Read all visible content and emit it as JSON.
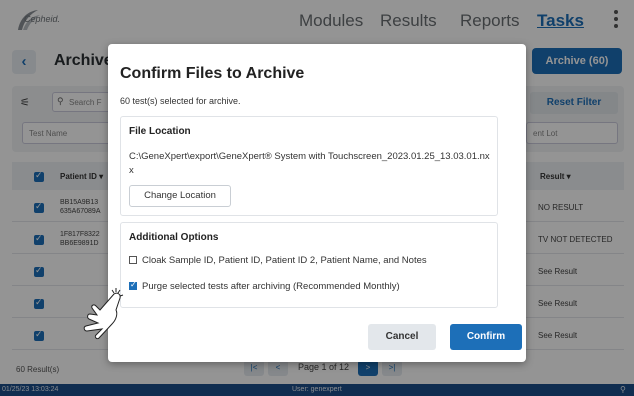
{
  "nav": {
    "logo_text": "Cepheid.",
    "modules": "Modules",
    "results": "Results",
    "reports": "Reports",
    "tasks": "Tasks",
    "accent_color": "#1d6fb8"
  },
  "page": {
    "title": "Archive",
    "archive_button": "Archive (60)",
    "search_placeholder": "Search F",
    "reset_filter": "Reset Filter",
    "test_name_placeholder": "Test Name",
    "reagent_lot_placeholder": "ent Lot",
    "columns": {
      "patient_id": "Patient ID ▾",
      "result": "Result ▾"
    },
    "rows": [
      {
        "patient": "BB15A9B13\n635A67089A",
        "result": "NO RESULT"
      },
      {
        "patient": "1F817F8322\nBB6E9891D",
        "result": "TV NOT DETECTED"
      },
      {
        "patient": "",
        "result": "See Result"
      },
      {
        "patient": "",
        "result": "See Result"
      },
      {
        "patient": "",
        "result": "See Result"
      }
    ],
    "results_count": "60 Result(s)",
    "pager": {
      "first": "|<",
      "prev": "<",
      "label": "Page 1 of 12",
      "next": ">",
      "last": ">|"
    }
  },
  "status": {
    "timestamp": "01/25/23 13:03:24",
    "user": "User: genexpert"
  },
  "dialog": {
    "title": "Confirm Files to Archive",
    "subtitle": "60 test(s) selected for archive.",
    "file_location": {
      "heading": "File Location",
      "path": "C:\\GeneXpert\\export\\GeneXpert® System with Touchscreen_2023.01.25_13.03.01.nxx",
      "change_button": "Change Location"
    },
    "options": {
      "heading": "Additional Options",
      "cloak_label": "Cloak Sample ID, Patient ID, Patient ID 2, Patient Name, and Notes",
      "cloak_checked": false,
      "purge_label": "Purge selected tests after archiving (Recommended Monthly)",
      "purge_checked": true
    },
    "cancel": "Cancel",
    "confirm": "Confirm"
  }
}
